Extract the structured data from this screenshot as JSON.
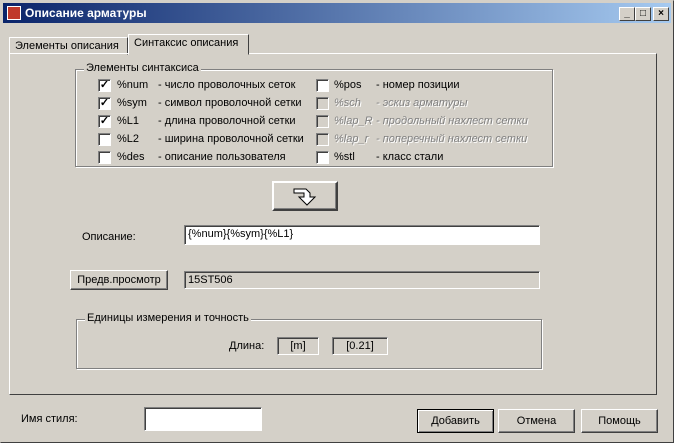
{
  "window": {
    "title": "Описание арматуры",
    "minimize": "_",
    "maximize": "□",
    "close": "×"
  },
  "tabs": [
    {
      "label": "Элементы описания",
      "active": false
    },
    {
      "label": "Синтаксис описания",
      "active": true
    }
  ],
  "syntax_group": {
    "title": "Элементы синтаксиса",
    "left": [
      {
        "code": "%num",
        "desc": "- число проволочных сеток",
        "checked": true
      },
      {
        "code": "%sym",
        "desc": "- символ проволочной сетки",
        "checked": true
      },
      {
        "code": "%L1",
        "desc": "- длина проволочной сетки",
        "checked": true
      },
      {
        "code": "%L2",
        "desc": "- ширина проволочной сетки",
        "checked": false
      },
      {
        "code": "%des",
        "desc": "- описание пользователя",
        "checked": false
      }
    ],
    "right": [
      {
        "code": "%pos",
        "desc": "- номер позиции",
        "checked": false,
        "enabled": true
      },
      {
        "code": "%sch",
        "desc": "- эскиз арматуры",
        "checked": false,
        "enabled": false
      },
      {
        "code": "%lap_R",
        "desc": "- продольный нахлест сетки",
        "checked": false,
        "enabled": false
      },
      {
        "code": "%lap_r",
        "desc": "- поперечный нахлест сетки",
        "checked": false,
        "enabled": false
      },
      {
        "code": "%stl",
        "desc": "- класс стали",
        "checked": false,
        "enabled": true
      }
    ]
  },
  "insert_button_icon": "insert-arrow-icon",
  "description": {
    "label": "Описание:",
    "value": "{%num}{%sym}{%L1}"
  },
  "preview": {
    "button_label": "Предв.просмотр",
    "value": "15ST506"
  },
  "units_group": {
    "title": "Единицы измерения и точность",
    "length_label": "Длина:",
    "unit": "[m]",
    "precision": "[0.21]"
  },
  "footer": {
    "style_name_label": "Имя стиля:",
    "style_name_value": "",
    "add_button": "Добавить",
    "cancel_button": "Отмена",
    "help_button": "Помощь"
  }
}
